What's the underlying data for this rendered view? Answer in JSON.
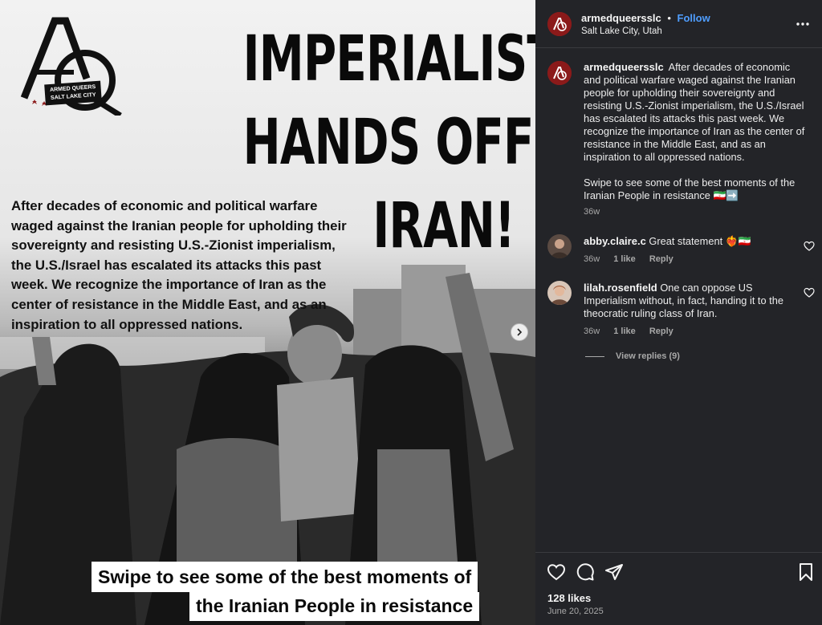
{
  "post_image": {
    "logo": {
      "line1": "ARMED QUEERS",
      "line2": "SALT LAKE CITY"
    },
    "headline": [
      "IMPERIALIST",
      "HANDS OFF",
      "IRAN!"
    ],
    "overlay_paragraph": "After decades of economic and political warfare waged against the Iranian people for upholding their sovereignty and resisting U.S.-Zionist imperialism, the U.S./Israel has escalated its attacks this past week. We recognize the importance of Iran as the center of resistance in the Middle East, and as an inspiration to all oppressed nations.",
    "caption_line1": "Swipe to see some of the best moments of",
    "caption_line2": "the Iranian People in resistance"
  },
  "header": {
    "username": "armedqueersslc",
    "separator": "•",
    "follow_label": "Follow",
    "location": "Salt Lake City, Utah"
  },
  "caption": {
    "username": "armedqueersslc",
    "text": "After decades of economic and political warfare waged against the Iranian people for upholding their sovereignty and resisting U.S.-Zionist imperialism, the U.S./Israel has escalated its attacks this past week. We recognize the importance of Iran as the center of resistance in the Middle East, and as an inspiration to all oppressed nations.",
    "text2": "Swipe to see some of the best moments of the Iranian People in resistance 🇮🇷➡️",
    "time": "36w"
  },
  "comments": [
    {
      "username": "abby.claire.c",
      "text": "Great statement ❤️‍🔥🇮🇷",
      "time": "36w",
      "likes": "1 like",
      "reply_label": "Reply"
    },
    {
      "username": "lilah.rosenfield",
      "text": "One can oppose US Imperialism without, in fact, handing it to the theocratic ruling class of Iran.",
      "time": "36w",
      "likes": "1 like",
      "reply_label": "Reply"
    }
  ],
  "view_replies_label": "View replies (9)",
  "likes_count": "128 likes",
  "post_date": "June 20, 2025",
  "colors": {
    "sidebar_bg": "#232428",
    "follow_blue": "#4f9eff",
    "brand_red": "#8b1a1a",
    "meta_gray": "#a8a8a8"
  },
  "icons": [
    "more-options-icon",
    "heart-icon",
    "comment-icon",
    "share-icon",
    "bookmark-icon",
    "chevron-right-icon"
  ]
}
